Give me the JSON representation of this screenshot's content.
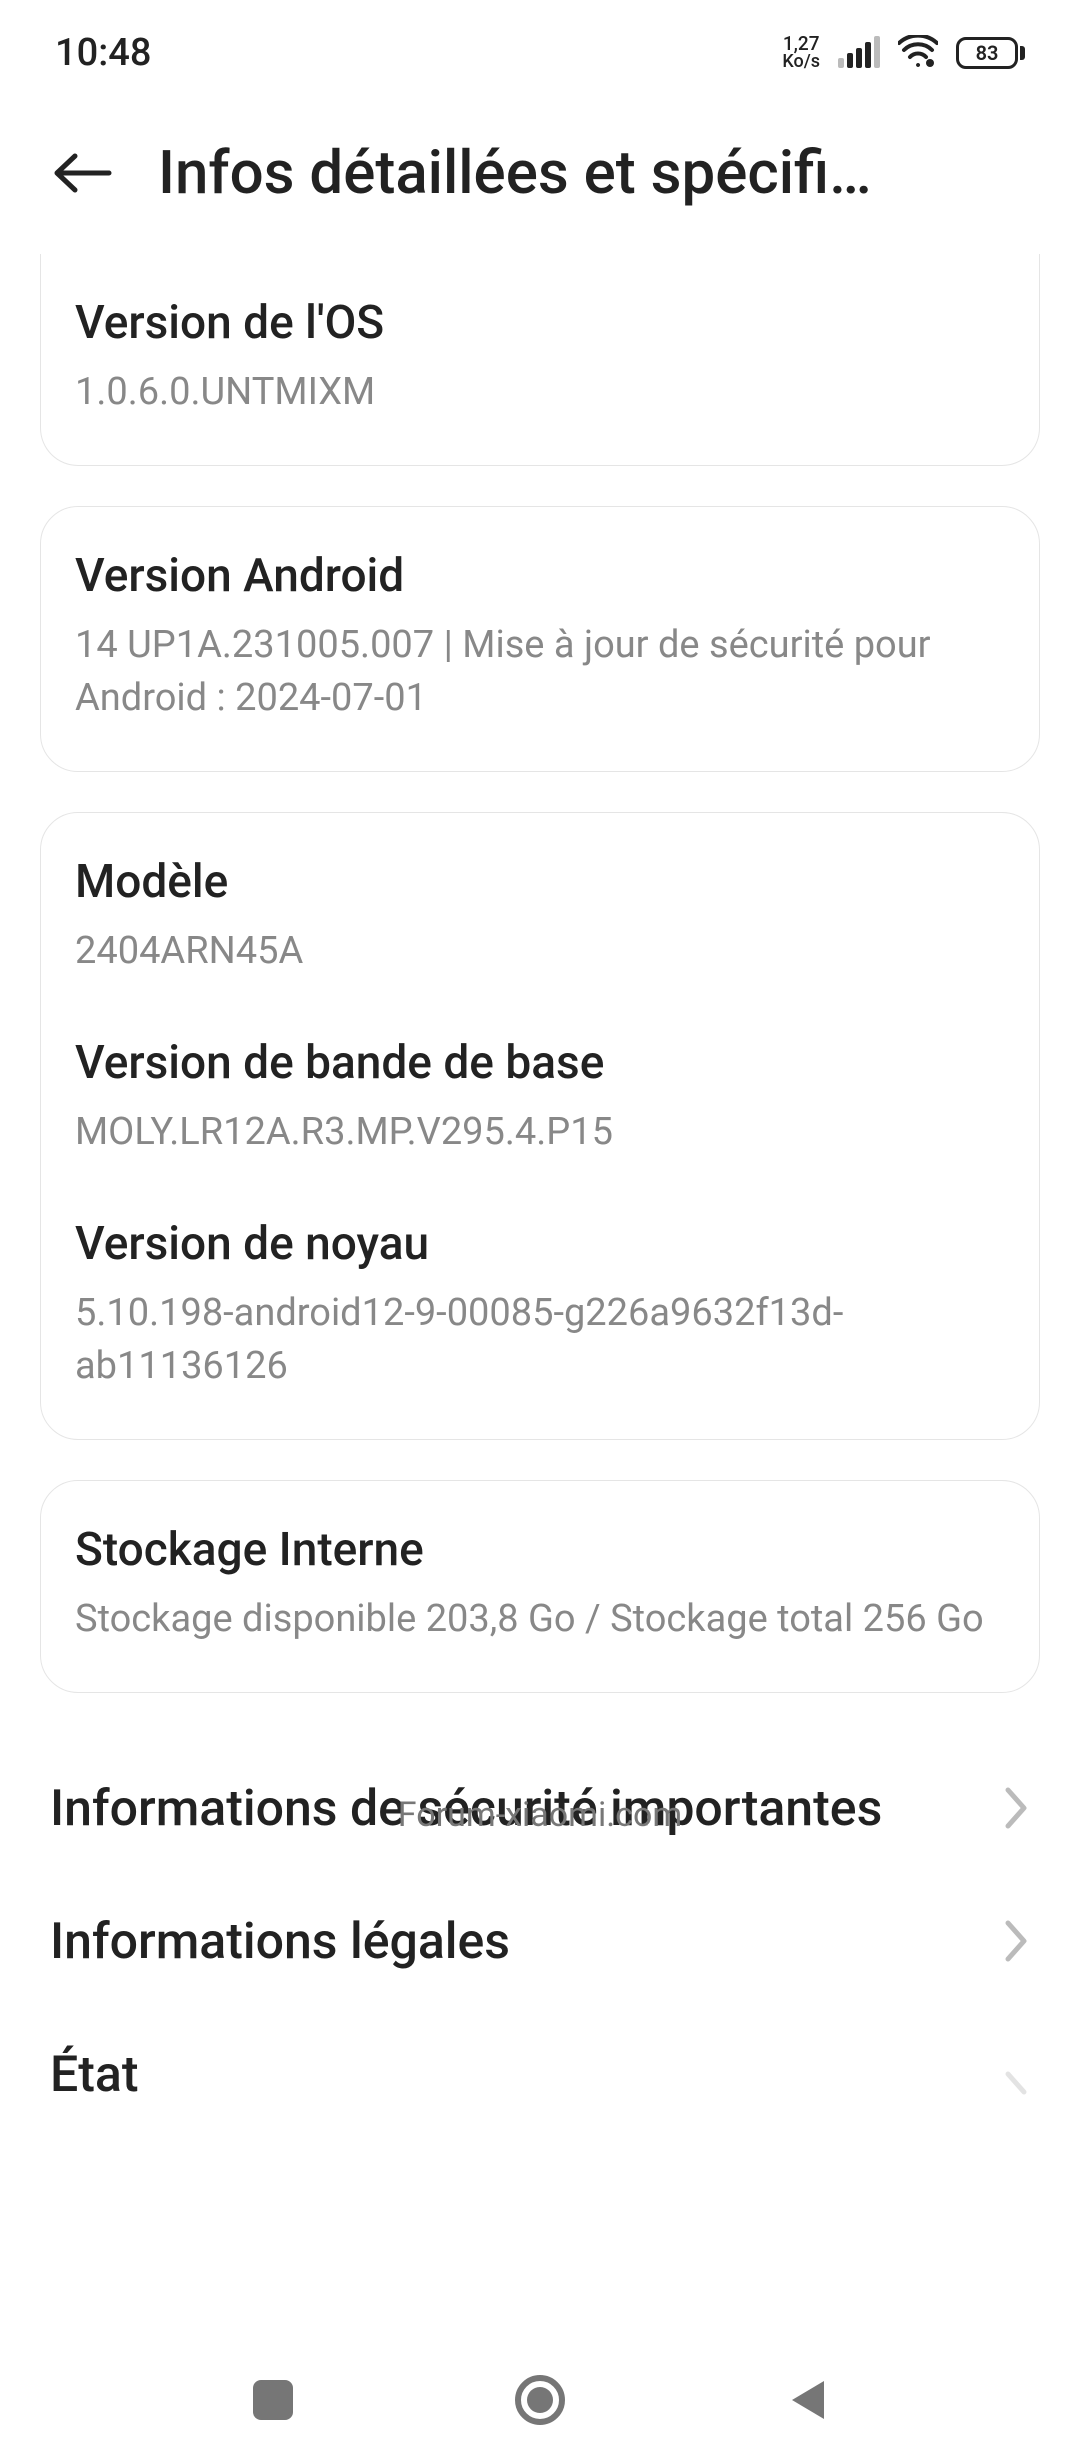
{
  "status": {
    "time": "10:48",
    "speed_top": "1,27",
    "speed_bot": "Ko/s",
    "battery": "83"
  },
  "header": {
    "title": "Infos détaillées et spécifi…"
  },
  "os": {
    "label": "Version de l'OS",
    "value": "1.0.6.0.UNTMIXM"
  },
  "android": {
    "label": "Version Android",
    "value": "14 UP1A.231005.007 | Mise à jour de sécurité pour Android : 2024-07-01"
  },
  "model": {
    "label": "Modèle",
    "value": "2404ARN45A"
  },
  "baseband": {
    "label": "Version de bande de base",
    "value": "MOLY.LR12A.R3.MP.V295.4.P15"
  },
  "kernel": {
    "label": "Version de noyau",
    "value": "5.10.198-android12-9-00085-g226a9632f13d-ab11136126"
  },
  "storage": {
    "label": "Stockage Interne",
    "value": "Stockage disponible  203,8 Go / Stockage total 256 Go"
  },
  "links": {
    "security": "Informations de sécurité importantes",
    "legal": "Informations légales",
    "status": "État"
  },
  "watermark": "Forum-xiaomi.com"
}
